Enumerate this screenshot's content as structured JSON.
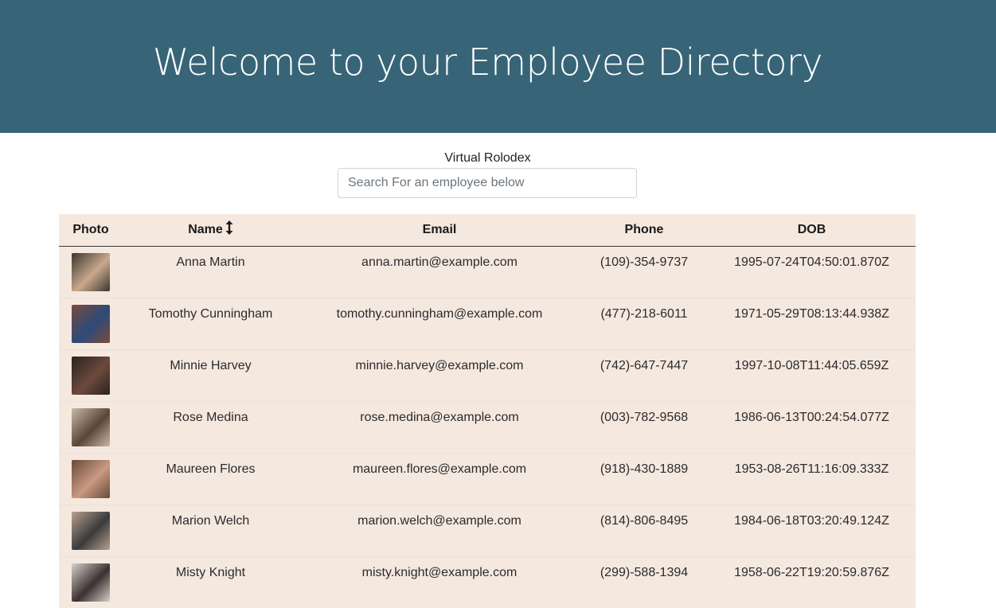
{
  "header": {
    "title": "Welcome to your Employee Directory"
  },
  "search": {
    "label": "Virtual Rolodex",
    "placeholder": "Search For an employee below",
    "value": ""
  },
  "table": {
    "columns": {
      "photo": "Photo",
      "name": "Name",
      "email": "Email",
      "phone": "Phone",
      "dob": "DOB"
    },
    "sort_icon": "sort-arrows-icon",
    "rows": [
      {
        "name": "Anna Martin",
        "email": "anna.martin@example.com",
        "phone": "(109)-354-9737",
        "dob": "1995-07-24T04:50:01.870Z",
        "photo_colors": [
          "#3b3530",
          "#caa98c"
        ]
      },
      {
        "name": "Tomothy Cunningham",
        "email": "tomothy.cunningham@example.com",
        "phone": "(477)-218-6011",
        "dob": "1971-05-29T08:13:44.938Z",
        "photo_colors": [
          "#7a4a3a",
          "#2d4a7a"
        ]
      },
      {
        "name": "Minnie Harvey",
        "email": "minnie.harvey@example.com",
        "phone": "(742)-647-7447",
        "dob": "1997-10-08T11:44:05.659Z",
        "photo_colors": [
          "#2a2220",
          "#6b4a3c"
        ]
      },
      {
        "name": "Rose Medina",
        "email": "rose.medina@example.com",
        "phone": "(003)-782-9568",
        "dob": "1986-06-13T00:24:54.077Z",
        "photo_colors": [
          "#c9b8a8",
          "#5a4636"
        ]
      },
      {
        "name": "Maureen Flores",
        "email": "maureen.flores@example.com",
        "phone": "(918)-430-1889",
        "dob": "1953-08-26T11:16:09.333Z",
        "photo_colors": [
          "#6a4a3a",
          "#c89a80"
        ]
      },
      {
        "name": "Marion Welch",
        "email": "marion.welch@example.com",
        "phone": "(814)-806-8495",
        "dob": "1984-06-18T03:20:49.124Z",
        "photo_colors": [
          "#b8a090",
          "#3a3a3a"
        ]
      },
      {
        "name": "Misty Knight",
        "email": "misty.knight@example.com",
        "phone": "(299)-588-1394",
        "dob": "1958-06-22T19:20:59.876Z",
        "photo_colors": [
          "#d8d0cc",
          "#3a3030"
        ]
      }
    ]
  }
}
